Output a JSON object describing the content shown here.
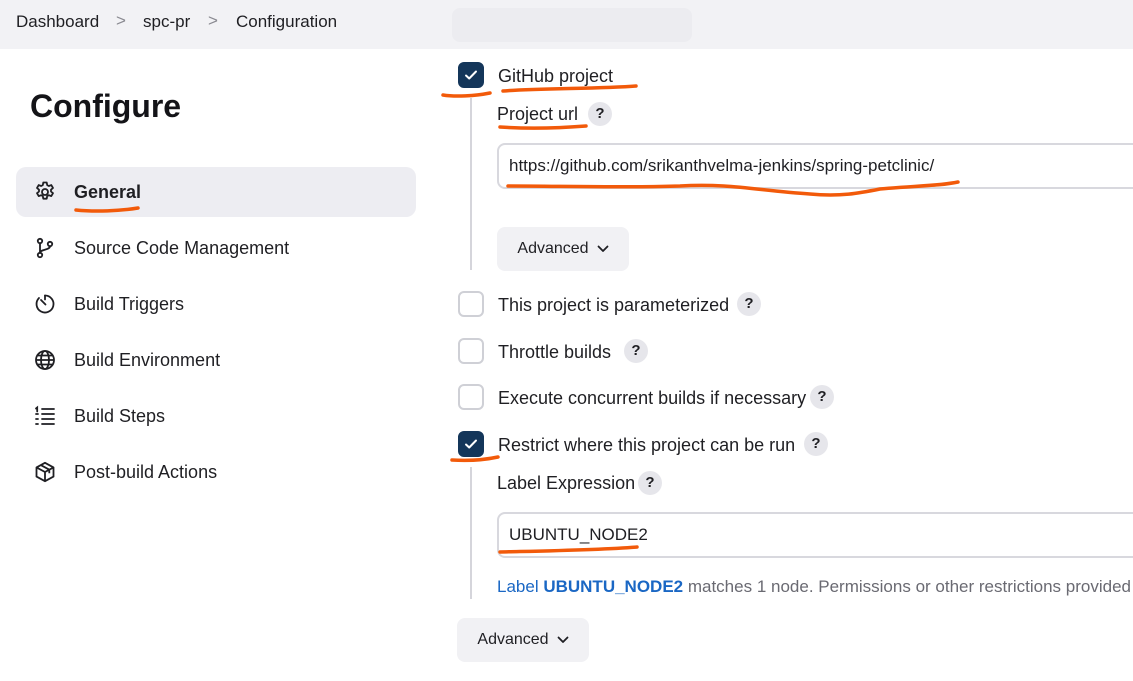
{
  "breadcrumb": {
    "items": [
      "Dashboard",
      "spc-pr",
      "Configuration"
    ],
    "separator": ">"
  },
  "sidebar": {
    "title": "Configure",
    "items": [
      {
        "label": "General",
        "icon": "gear-icon",
        "active": true
      },
      {
        "label": "Source Code Management",
        "icon": "branch-icon"
      },
      {
        "label": "Build Triggers",
        "icon": "timer-icon"
      },
      {
        "label": "Build Environment",
        "icon": "globe-icon"
      },
      {
        "label": "Build Steps",
        "icon": "list-icon"
      },
      {
        "label": "Post-build Actions",
        "icon": "package-icon"
      }
    ]
  },
  "form": {
    "github_project": {
      "label": "GitHub project",
      "checked": true
    },
    "project_url": {
      "label": "Project url",
      "value": "https://github.com/srikanthvelma-jenkins/spring-petclinic/"
    },
    "advanced_label": "Advanced",
    "parameterized": {
      "label": "This project is parameterized",
      "checked": false
    },
    "throttle": {
      "label": "Throttle builds",
      "checked": false
    },
    "concurrent": {
      "label": "Execute concurrent builds if necessary",
      "checked": false
    },
    "restrict": {
      "label": "Restrict where this project can be run",
      "checked": true
    },
    "label_expression": {
      "label": "Label Expression",
      "value": "UBUNTU_NODE2",
      "info_prefix": "Label ",
      "info_link": "UBUNTU_NODE2",
      "info_rest": " matches 1 node. Permissions or other restrictions provided"
    },
    "help_glyph": "?"
  },
  "colors": {
    "accent": "#14365a",
    "annotation": "#f25a0a",
    "link": "#1a67c4"
  }
}
